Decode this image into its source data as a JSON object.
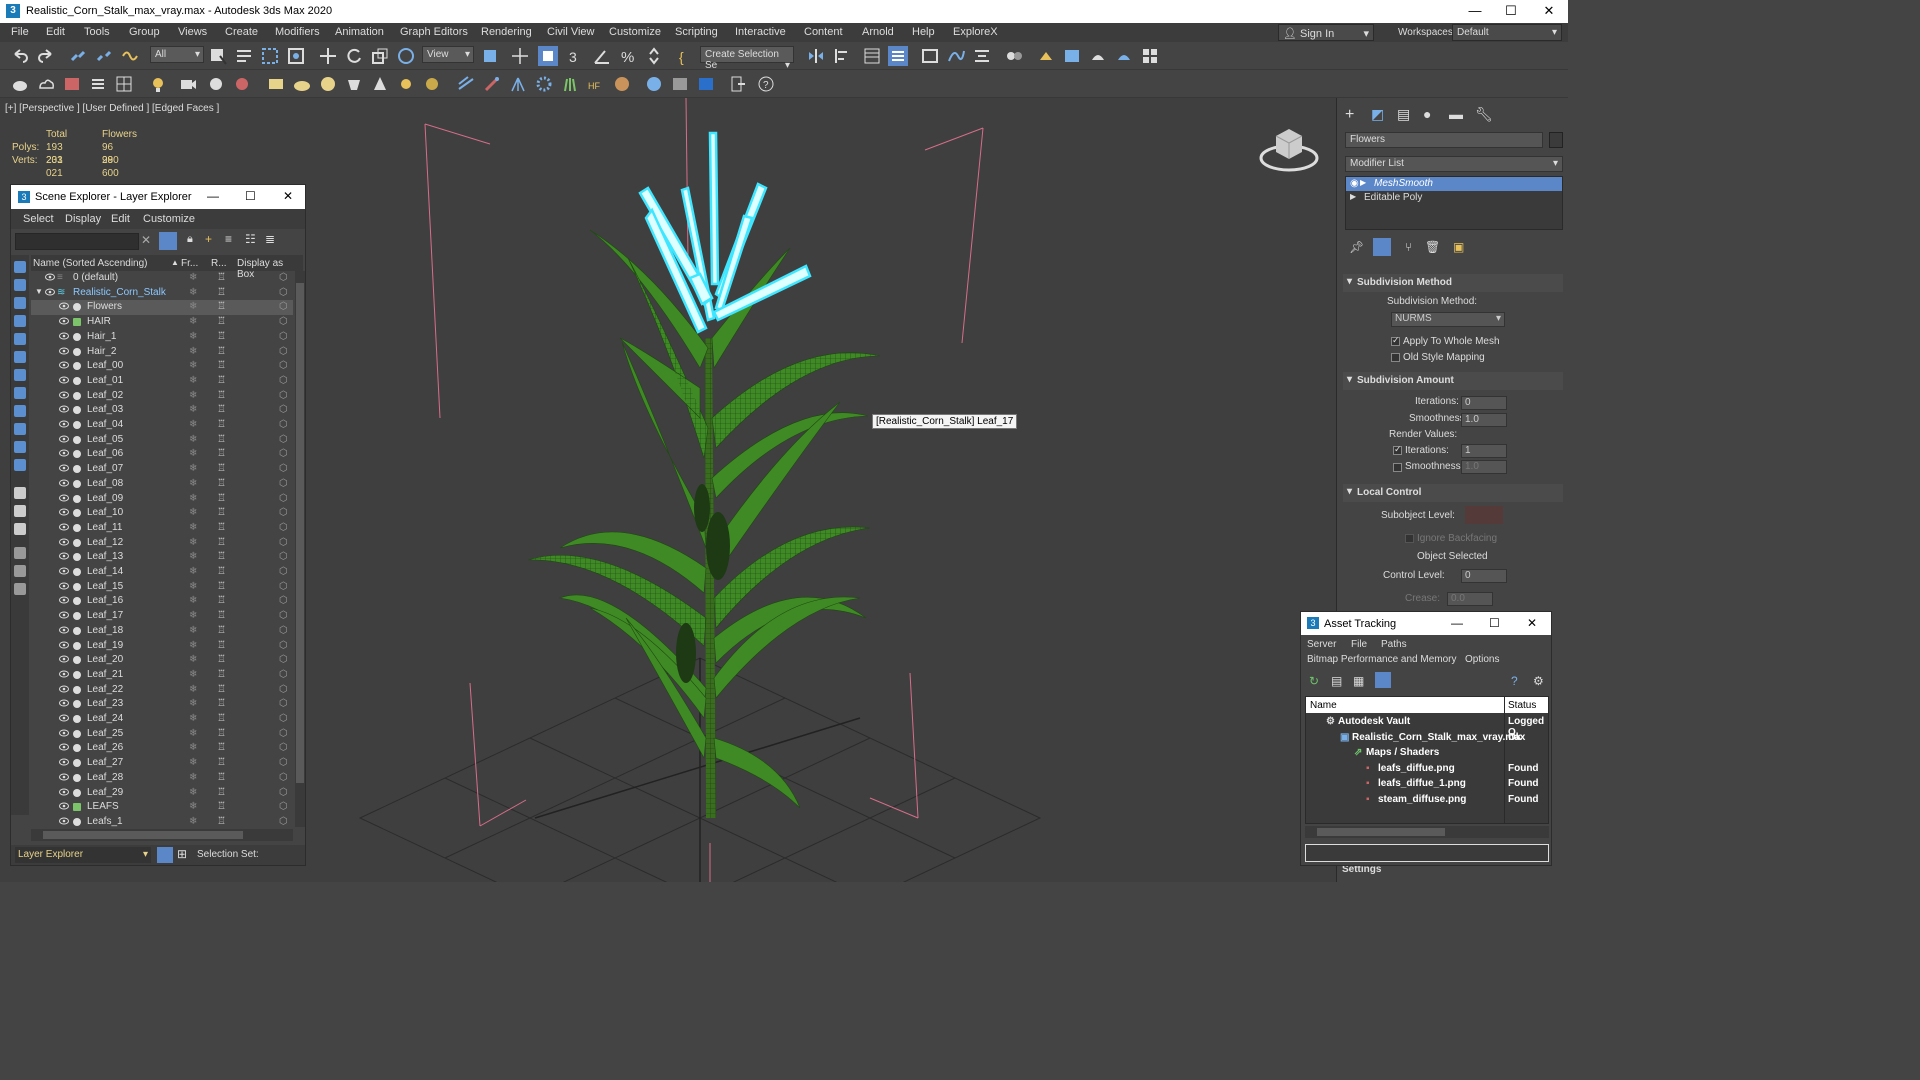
{
  "window": {
    "title": "Realistic_Corn_Stalk_max_vray.max - Autodesk 3ds Max 2020",
    "app_glyph": "3"
  },
  "menu": [
    "File",
    "Edit",
    "Tools",
    "Group",
    "Views",
    "Create",
    "Modifiers",
    "Animation",
    "Graph Editors",
    "Rendering",
    "Civil View",
    "Customize",
    "Scripting",
    "Interactive",
    "Content",
    "Arnold",
    "Help",
    "ExploreX"
  ],
  "signin": "Sign In",
  "workspaces": {
    "label": "Workspaces:",
    "value": "Default"
  },
  "toolbar": {
    "filter": "All",
    "ref_coord": "View",
    "create_selection_set": "Create Selection Se"
  },
  "viewport": {
    "label": "[+] [Perspective ] [User Defined ] [Edged Faces ]",
    "stats": {
      "total_header": "Total",
      "sel_header": "Flowers",
      "polys_label": "Polys:",
      "polys_total": "193 233",
      "polys_sel": "96 280",
      "verts_label": "Verts:",
      "verts_total": "201 021",
      "verts_sel": "99 600"
    },
    "tooltip": "[Realistic_Corn_Stalk] Leaf_17"
  },
  "scene_explorer": {
    "title": "Scene Explorer - Layer Explorer",
    "menu": [
      "Select",
      "Display",
      "Edit",
      "Customize"
    ],
    "columns": {
      "name": "Name (Sorted Ascending)",
      "frozen": "Fr...",
      "render": "R...",
      "box": "Display as Box"
    },
    "rows": [
      "0 (default)",
      "Realistic_Corn_Stalk",
      "Flowers",
      "HAIR",
      "Hair_1",
      "Hair_2",
      "Leaf_00",
      "Leaf_01",
      "Leaf_02",
      "Leaf_03",
      "Leaf_04",
      "Leaf_05",
      "Leaf_06",
      "Leaf_07",
      "Leaf_08",
      "Leaf_09",
      "Leaf_10",
      "Leaf_11",
      "Leaf_12",
      "Leaf_13",
      "Leaf_14",
      "Leaf_15",
      "Leaf_16",
      "Leaf_17",
      "Leaf_18",
      "Leaf_19",
      "Leaf_20",
      "Leaf_21",
      "Leaf_22",
      "Leaf_23",
      "Leaf_24",
      "Leaf_25",
      "Leaf_26",
      "Leaf_27",
      "Leaf_28",
      "Leaf_29",
      "LEAFS",
      "Leafs_1"
    ],
    "bottom": {
      "explorer": "Layer Explorer",
      "selection_set": "Selection Set:"
    }
  },
  "command_panel": {
    "object_name": "Flowers",
    "modifier_list": "Modifier List",
    "stack": [
      "MeshSmooth",
      "Editable Poly"
    ],
    "subdivision_method": {
      "header": "Subdivision Method",
      "label": "Subdivision Method:",
      "value": "NURMS",
      "apply_whole": "Apply To Whole Mesh",
      "old_style": "Old Style Mapping"
    },
    "subdivision_amount": {
      "header": "Subdivision Amount",
      "iterations_label": "Iterations:",
      "iterations": "0",
      "smoothness_label": "Smoothness:",
      "smoothness": "1.0",
      "render_values": "Render Values:",
      "r_iterations_label": "Iterations:",
      "r_iterations": "1",
      "r_smoothness_label": "Smoothness:",
      "r_smoothness": "1.0"
    },
    "local_control": {
      "header": "Local Control",
      "subobject": "Subobject Level:",
      "ignore_backfacing": "Ignore Backfacing",
      "object_selected": "Object Selected",
      "control_level_label": "Control Level:",
      "control_level": "0",
      "crease_label": "Crease:",
      "crease": "0.0"
    },
    "settings": "Settings"
  },
  "asset_tracking": {
    "title": "Asset Tracking",
    "menu1": [
      "Server",
      "File",
      "Paths"
    ],
    "menu2": [
      "Bitmap Performance and Memory",
      "Options"
    ],
    "columns": {
      "name": "Name",
      "status": "Status"
    },
    "rows": [
      {
        "name": "Autodesk Vault",
        "status": "Logged O"
      },
      {
        "name": "Realistic_Corn_Stalk_max_vray.max",
        "status": "Ok"
      },
      {
        "name": "Maps / Shaders",
        "status": ""
      },
      {
        "name": "leafs_diffue.png",
        "status": "Found"
      },
      {
        "name": "leafs_diffue_1.png",
        "status": "Found"
      },
      {
        "name": "steam_diffuse.png",
        "status": "Found"
      }
    ]
  }
}
